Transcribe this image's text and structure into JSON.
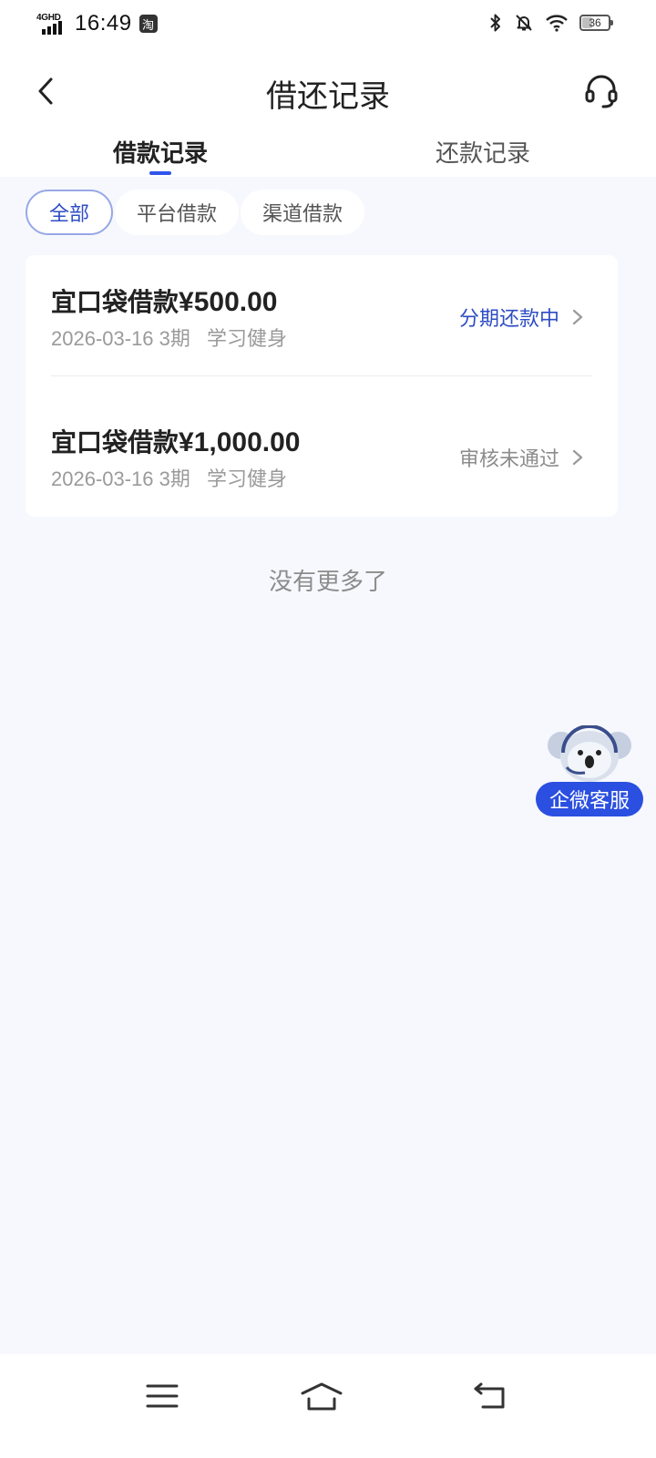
{
  "status_bar": {
    "network": "4GHD",
    "time": "16:49",
    "app_badge": "淘",
    "battery": "36"
  },
  "header": {
    "title": "借还记录",
    "back_icon": "chevron-left-icon",
    "support_icon": "headset-icon"
  },
  "tabs": [
    {
      "label": "借款记录",
      "active": true
    },
    {
      "label": "还款记录",
      "active": false
    }
  ],
  "filters": [
    {
      "label": "全部",
      "active": true
    },
    {
      "label": "平台借款",
      "active": false
    },
    {
      "label": "渠道借款",
      "active": false
    }
  ],
  "loans": [
    {
      "title": "宜口袋借款",
      "amount": "¥500.00",
      "date": "2026-03-16",
      "term": "3期",
      "purpose": "学习健身",
      "status": "分期还款中",
      "status_color": "#2e4dc4"
    },
    {
      "title": "宜口袋借款",
      "amount": "¥1,000.00",
      "date": "2026-03-16",
      "term": "3期",
      "purpose": "学习健身",
      "status": "审核未通过",
      "status_color": "#8c8c8c"
    }
  ],
  "list_end": "没有更多了",
  "float_service": {
    "label": "企微客服"
  },
  "colors": {
    "accent": "#2e4dc4",
    "background": "#f6f8fd"
  }
}
